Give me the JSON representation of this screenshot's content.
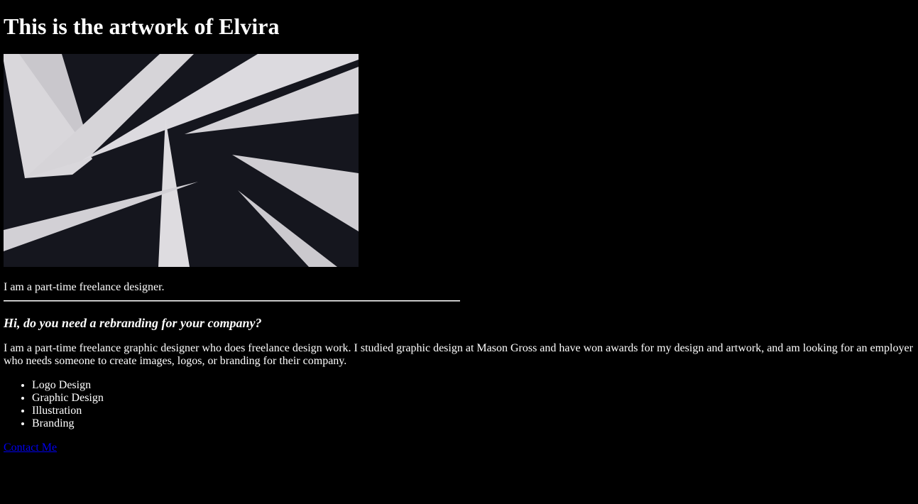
{
  "page": {
    "title": "This is the artwork of Elvira",
    "artwork": {
      "alt": "Abstract artwork of white triangular shards on dark background",
      "colors": {
        "background": "#15161e",
        "shard": "#d8d6da"
      }
    },
    "tagline": "I am a part-time freelance designer.",
    "subheading": "Hi, do you need a rebranding for your company?",
    "bio": "I am a part-time freelance graphic designer who does freelance design work. I studied graphic design at Mason Gross and have won awards for my design and artwork, and am looking for an employer who needs someone to create images, logos, or branding for their company.",
    "services": [
      "Logo Design",
      "Graphic Design",
      "Illustration",
      "Branding"
    ],
    "contact_label": "Contact Me"
  }
}
